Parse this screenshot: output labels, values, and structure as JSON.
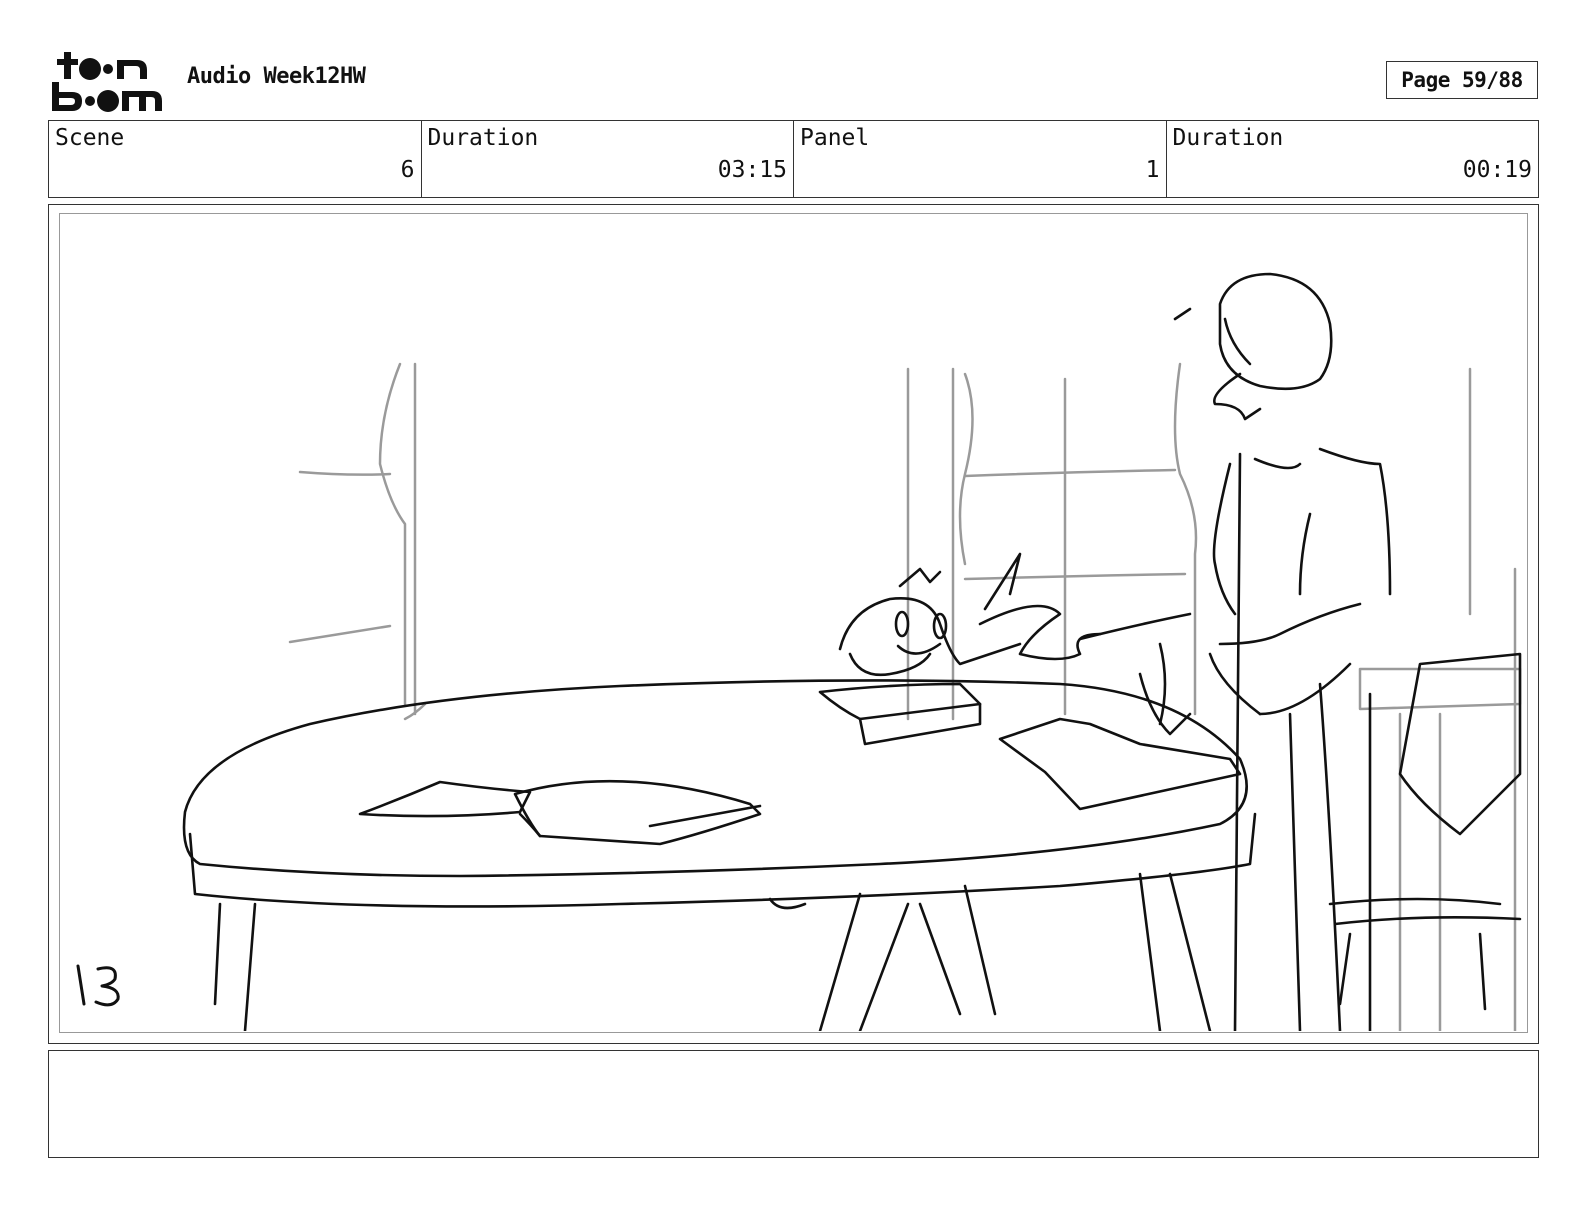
{
  "header": {
    "logo_text": "toon boom",
    "title": "Audio Week12HW",
    "page_label": "Page 59/88"
  },
  "info": {
    "scene_label": "Scene",
    "scene_value": "6",
    "scene_duration_label": "Duration",
    "scene_duration_value": "03:15",
    "panel_label": "Panel",
    "panel_value": "1",
    "panel_duration_label": "Duration",
    "panel_duration_value": "00:19"
  },
  "panel": {
    "content": "storyboard-sketch",
    "handwritten_number": "13"
  },
  "notes": {
    "text": ""
  }
}
